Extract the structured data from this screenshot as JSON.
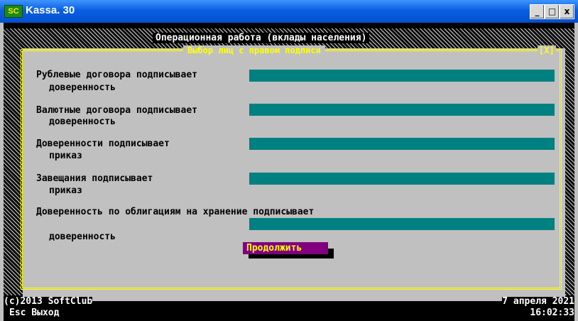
{
  "window": {
    "title": "Kassa. 30",
    "icon_text": "SC",
    "minimize": "_",
    "maximize": "□",
    "close": "x"
  },
  "header": {
    "title": "Операционная работа (вклады населения)"
  },
  "dialog": {
    "title": "Выбор лиц с правом подписи",
    "close": "[X]",
    "rows": [
      {
        "label": "Рублевые договора подписывает",
        "value": "доверенность"
      },
      {
        "label": "Валютные договора подписывает",
        "value": "доверенность"
      },
      {
        "label": "Доверенности подписывает",
        "value": "приказ"
      },
      {
        "label": "Завещания подписывает",
        "value": "приказ"
      },
      {
        "label": "Доверенность по облигациям на хранение подписывает",
        "value": "доверенность"
      }
    ],
    "continue_label": "Продолжить"
  },
  "status": {
    "copyright": "(c)2013 SoftClub",
    "exit_hint": "Esc Выход",
    "date": "7 апреля 2021",
    "time": "16:02:33"
  },
  "colors": {
    "field": "#008080",
    "border": "#ffff00",
    "button": "#800080",
    "titlebar": "#0a5fe0"
  }
}
